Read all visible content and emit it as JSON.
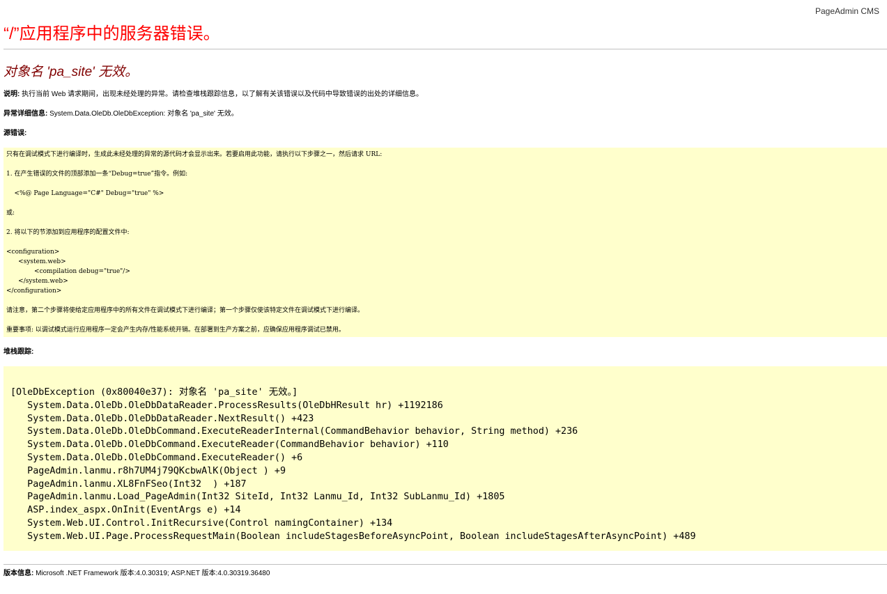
{
  "bookmarks": [],
  "brand": "PageAdmin CMS",
  "title": "“/”应用程序中的服务器错误。",
  "error_message": "对象名 'pa_site' 无效。",
  "description": {
    "label": "说明:",
    "text": " 执行当前 Web 请求期间，出现未经处理的异常。请检查堆栈跟踪信息，以了解有关该错误以及代码中导致错误的出处的详细信息。"
  },
  "exception_details": {
    "label": "异常详细信息:",
    "text": " System.Data.OleDb.OleDbException: 对象名 'pa_site' 无效。"
  },
  "source_error": {
    "label": "源错误:",
    "lines": [
      "只有在调试模式下进行编译时，生成此未经处理的异常的源代码才会显示出来。若要启用此功能，请执行以下步骤之一，然后请求 URL:",
      "",
      "1. 在产生错误的文件的顶部添加一条“Debug=true”指令。例如:",
      "",
      "    <%@ Page Language=\"C#\" Debug=\"true\" %>",
      "",
      "或:",
      "",
      "2. 将以下的节添加到应用程序的配置文件中:",
      "",
      "<configuration>",
      "      <system.web>",
      "              <compilation debug=\"true\"/>",
      "      </system.web>",
      "</configuration>",
      "",
      "请注意，第二个步骤将使给定应用程序中的所有文件在调试模式下进行编译；第一个步骤仅使该特定文件在调试模式下进行编译。",
      "",
      "重要事项: 以调试模式运行应用程序一定会产生内存/性能系统开销。在部署到生产方案之前，应确保应用程序调试已禁用。"
    ]
  },
  "stack_trace": {
    "label": "堆栈跟踪:",
    "lines": [
      "[OleDbException (0x80040e37): 对象名 'pa_site' 无效。]",
      "   System.Data.OleDb.OleDbDataReader.ProcessResults(OleDbHResult hr) +1192186",
      "   System.Data.OleDb.OleDbDataReader.NextResult() +423",
      "   System.Data.OleDb.OleDbCommand.ExecuteReaderInternal(CommandBehavior behavior, String method) +236",
      "   System.Data.OleDb.OleDbCommand.ExecuteReader(CommandBehavior behavior) +110",
      "   System.Data.OleDb.OleDbCommand.ExecuteReader() +6",
      "   PageAdmin.lanmu.r8h7UM4j79QKcbwAlK(Object ) +9",
      "   PageAdmin.lanmu.XL8FnFSeo(Int32  ) +187",
      "   PageAdmin.lanmu.Load_PageAdmin(Int32 SiteId, Int32 Lanmu_Id, Int32 SubLanmu_Id) +1805",
      "   ASP.index_aspx.OnInit(EventArgs e) +14",
      "   System.Web.UI.Control.InitRecursive(Control namingContainer) +134",
      "   System.Web.UI.Page.ProcessRequestMain(Boolean includeStagesBeforeAsyncPoint, Boolean includeStagesAfterAsyncPoint) +489"
    ]
  },
  "version_info": {
    "label": "版本信息:",
    "text": " Microsoft .NET Framework 版本:4.0.30319; ASP.NET 版本:4.0.30319.36480"
  }
}
